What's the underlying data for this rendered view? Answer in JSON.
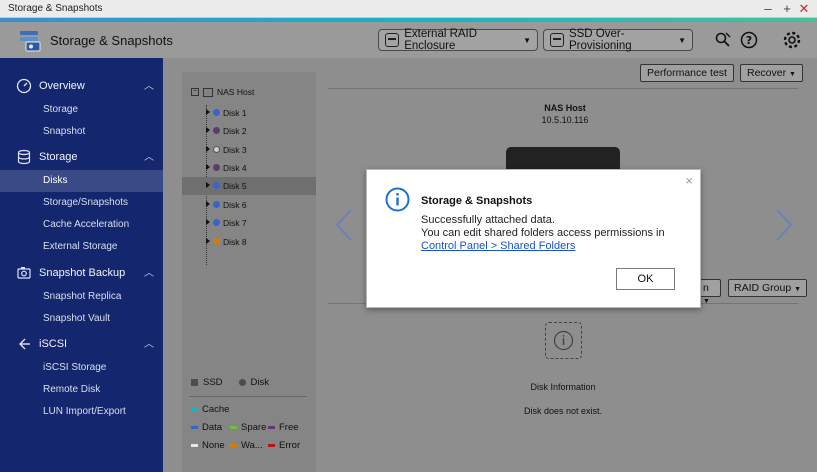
{
  "window": {
    "title": "Storage & Snapshots",
    "controls": [
      "–",
      "+",
      "✕"
    ]
  },
  "colors": {
    "sidebar": "#14276e",
    "accent": "#1e88c8",
    "link": "#1a55c9",
    "close_red": "#d12a2a"
  },
  "header": {
    "app_title": "Storage & Snapshots",
    "external_raid": "External RAID Enclosure",
    "ssd_op": "SSD Over-Provisioning",
    "icons": [
      "search-settings-icon",
      "help-icon",
      "gear-icon"
    ]
  },
  "sidebar": {
    "sections": [
      {
        "label": "Overview",
        "icon": "gauge-icon",
        "items": [
          "Storage",
          "Snapshot"
        ]
      },
      {
        "label": "Storage",
        "icon": "database-icon",
        "items": [
          "Disks",
          "Storage/Snapshots",
          "Cache Acceleration",
          "External Storage"
        ]
      },
      {
        "label": "Snapshot Backup",
        "icon": "snapshot-backup-icon",
        "items": [
          "Snapshot Replica",
          "Snapshot Vault"
        ]
      },
      {
        "label": "iSCSI",
        "icon": "iscsi-icon",
        "items": [
          "iSCSI Storage",
          "Remote Disk",
          "LUN Import/Export"
        ]
      }
    ],
    "active_item": "Disks"
  },
  "tree": {
    "root": "NAS Host",
    "disks": [
      {
        "name": "Disk 1",
        "color": "#3a63c9"
      },
      {
        "name": "Disk 2",
        "color": "#5e3a6e"
      },
      {
        "name": "Disk 3",
        "color": "#cfcfcf"
      },
      {
        "name": "Disk 4",
        "color": "#5e3a6e"
      },
      {
        "name": "Disk 5",
        "color": "#3a63c9"
      },
      {
        "name": "Disk 6",
        "color": "#3a63c9"
      },
      {
        "name": "Disk 7",
        "color": "#3a63c9"
      },
      {
        "name": "Disk 8",
        "color": "#d17b10"
      }
    ],
    "selected": "Disk 5"
  },
  "legend": {
    "ssd": "SSD",
    "disk": "Disk",
    "cache": "Cache",
    "data": "Data",
    "spare": "Spare",
    "free": "Free",
    "none": "None",
    "warning": "Wa...",
    "error": "Error"
  },
  "toolbar": {
    "performance_test": "Performance test",
    "recover": "Recover"
  },
  "nas": {
    "label": "NAS Host",
    "ip": "10.5.10.116"
  },
  "selectors": {
    "partial": "n",
    "raid_group": "RAID Group"
  },
  "disk_info": {
    "title": "Disk Information",
    "text": "Disk does not exist."
  },
  "dialog": {
    "title": "Storage & Snapshots",
    "line1": "Successfully attached data.",
    "line2": "You can edit shared folders access permissions in",
    "link": "Control Panel > Shared Folders",
    "ok": "OK",
    "close": "×"
  }
}
